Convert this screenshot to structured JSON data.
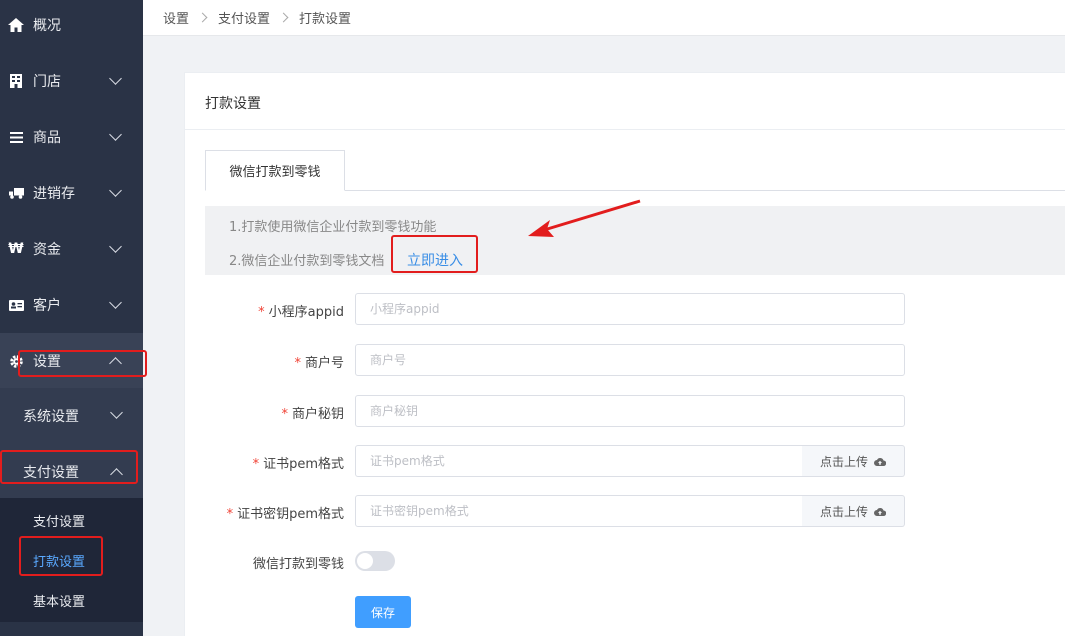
{
  "sidebar": {
    "items": [
      {
        "label": "概况",
        "icon": "home-icon"
      },
      {
        "label": "门店",
        "icon": "building-icon"
      },
      {
        "label": "商品",
        "icon": "list-icon"
      },
      {
        "label": "进销存",
        "icon": "truck-icon"
      },
      {
        "label": "资金",
        "icon": "won-icon"
      },
      {
        "label": "客户",
        "icon": "id-card-icon"
      },
      {
        "label": "设置",
        "icon": "gear-icon"
      }
    ],
    "sub_items": [
      {
        "label": "系统设置"
      },
      {
        "label": "支付设置"
      }
    ],
    "leaf_items": [
      {
        "label": "支付设置"
      },
      {
        "label": "打款设置"
      },
      {
        "label": "基本设置"
      }
    ]
  },
  "breadcrumb": [
    "设置",
    "支付设置",
    "打款设置"
  ],
  "card": {
    "title": "打款设置",
    "tab": "微信打款到零钱",
    "notice_line1": "1.打款使用微信企业付款到零钱功能",
    "notice_line2": "2.微信企业付款到零钱文档",
    "notice_link": "立即进入"
  },
  "form": {
    "fields": [
      {
        "label": "小程序appid",
        "placeholder": "小程序appid",
        "required": "*"
      },
      {
        "label": "商户号",
        "placeholder": "商户号",
        "required": "*"
      },
      {
        "label": "商户秘钥",
        "placeholder": "商户秘钥",
        "required": "*"
      },
      {
        "label": "证书pem格式",
        "placeholder": "证书pem格式",
        "required": "*"
      },
      {
        "label": "证书密钥pem格式",
        "placeholder": "证书密钥pem格式",
        "required": "*"
      }
    ],
    "upload_label": "点击上传",
    "switch_label": "微信打款到零钱",
    "switch_on": false,
    "save_label": "保存"
  },
  "colors": {
    "sidebar_bg": "#2a3346",
    "accent": "#409eff",
    "link": "#3a8ee6",
    "annotation": "#e21d1d"
  }
}
